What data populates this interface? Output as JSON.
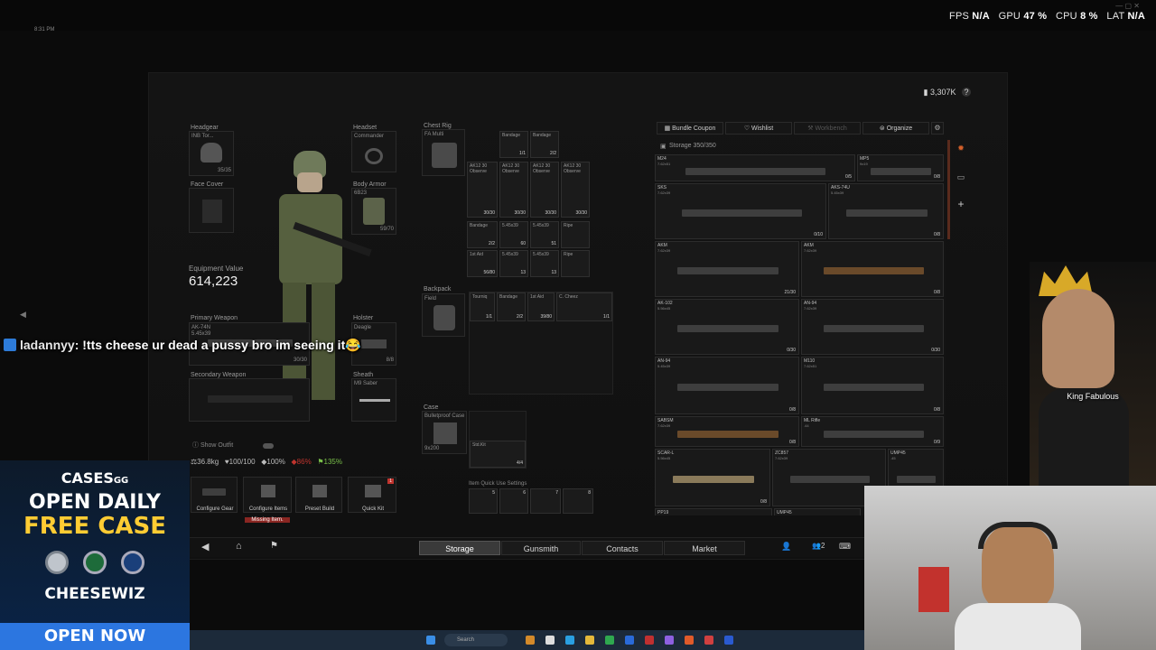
{
  "overlay": {
    "time": "8:31 PM",
    "fps_label": "FPS",
    "fps_value": "N/A",
    "gpu_label": "GPU",
    "gpu_value": "47 %",
    "cpu_label": "CPU",
    "cpu_value": "8 %",
    "lat_label": "LAT",
    "lat_value": "N/A"
  },
  "header": {
    "money": "3,307K",
    "help": "?"
  },
  "equipment": {
    "headgear": {
      "label": "Headgear",
      "item": "INB Tor...",
      "durability": "35/35"
    },
    "headset": {
      "label": "Headset",
      "item": "Commander"
    },
    "face_cover": {
      "label": "Face Cover"
    },
    "body_armor": {
      "label": "Body Armor",
      "item": "6B23",
      "durability": "59/70"
    },
    "equipment_value_label": "Equipment Value",
    "equipment_value": "614,223",
    "primary_weapon": {
      "label": "Primary Weapon",
      "item": "AK-74N",
      "sub": "5.45x39",
      "ammo": "30/30"
    },
    "holster": {
      "label": "Holster",
      "item": "Deagle",
      "ammo": "8/8"
    },
    "secondary_weapon": {
      "label": "Secondary Weapon"
    },
    "sheath": {
      "label": "Sheath",
      "item": "M9 Saber"
    },
    "show_outfit": "Show Outfit",
    "stats": {
      "weight": "36.8kg",
      "hp": "100/100",
      "hydration": "100%",
      "energy": "86%",
      "mod": "135%"
    },
    "actions": [
      {
        "label": "Configure Gear"
      },
      {
        "label": "Configure Items",
        "warning": "Missing Item."
      },
      {
        "label": "Preset Build"
      },
      {
        "label": "Quick Kit",
        "badge": "1"
      }
    ]
  },
  "chest_rig": {
    "label": "Chest Rig",
    "item": "FA Multi",
    "items": [
      {
        "name": "Bandage",
        "qty": "1/1"
      },
      {
        "name": "Bandage",
        "qty": "2/2"
      },
      {
        "name": "AK12 30 Observe",
        "qty": "30/30"
      },
      {
        "name": "AK12 30 Observe",
        "qty": "30/30"
      },
      {
        "name": "AK12 30 Observe",
        "qty": "30/30"
      },
      {
        "name": "AK12 30 Observe",
        "qty": "30/30"
      },
      {
        "name": "Bandage",
        "qty": "2/2"
      },
      {
        "name": "5.45x39",
        "qty": "60"
      },
      {
        "name": "5.45x39",
        "qty": "51"
      },
      {
        "name": "Ripe",
        "qty": ""
      },
      {
        "name": "1st Aid",
        "qty": "56/80"
      },
      {
        "name": "5.45x39",
        "qty": "13"
      },
      {
        "name": "5.45x39",
        "qty": "13"
      },
      {
        "name": "Ripe",
        "qty": ""
      }
    ]
  },
  "backpack": {
    "label": "Backpack",
    "item": "Field",
    "items": [
      {
        "name": "Tourniq",
        "qty": "1/1"
      },
      {
        "name": "Bandage",
        "qty": "2/2"
      },
      {
        "name": "1st Aid",
        "qty": "39/80"
      },
      {
        "name": "C. Cheez",
        "qty": "1/1"
      }
    ]
  },
  "case": {
    "label": "Case",
    "item": "Bulletproof Case",
    "size": "9x200",
    "sub_item": "Std.Kit",
    "sub_qty": "4/4"
  },
  "quick_use": {
    "label": "Item Quick Use Settings",
    "slots": [
      "5",
      "6",
      "7",
      "8"
    ]
  },
  "storage_tabs": {
    "bundle": "Bundle Coupon",
    "wishlist": "Wishlist",
    "workbench": "Workbench",
    "organize": "Organize"
  },
  "storage": {
    "label": "Storage 350/350",
    "weapons": [
      {
        "name": "M24",
        "sub": "7.62x51",
        "count": "0/5"
      },
      {
        "name": "MP5",
        "sub": "9x19",
        "count": "0/8"
      },
      {
        "name": "SKS",
        "sub": "7.62x39",
        "count": "0/10"
      },
      {
        "name": "AKS-74U",
        "sub": "5.45x39",
        "count": "0/8"
      },
      {
        "name": "AKM",
        "sub": "7.62x39",
        "count": "21/30"
      },
      {
        "name": "AKM",
        "sub": "7.62x39",
        "count": "0/8"
      },
      {
        "name": "AK-102",
        "sub": "5.56x45",
        "count": "0/30"
      },
      {
        "name": "AN-94",
        "sub": "7.62x39",
        "count": "0/30"
      },
      {
        "name": "AN-94",
        "sub": "5.45x39",
        "count": "0/8"
      },
      {
        "name": "M110",
        "sub": "7.62x51",
        "count": "0/8"
      },
      {
        "name": "SABSM",
        "sub": "7.62x39",
        "count": "0/8"
      },
      {
        "name": "ML Rifle",
        "sub": ".44",
        "count": "0/9"
      },
      {
        "name": "SCAR-L",
        "sub": "5.56x45",
        "count": "0/8"
      },
      {
        "name": "ZC857",
        "sub": "7.62x39",
        "count": ""
      },
      {
        "name": "UMP45",
        "sub": ".45",
        "count": ""
      },
      {
        "name": "PP19",
        "sub": "9x19",
        "count": ""
      },
      {
        "name": "UMP45",
        "sub": ".45",
        "count": ""
      }
    ]
  },
  "nav": {
    "storage": "Storage",
    "gunsmith": "Gunsmith",
    "contacts": "Contacts",
    "market": "Market",
    "party_count": "2"
  },
  "chat": {
    "user": "ladannyy:",
    "message": "!tts cheese ur dead a pussy bro im seeing it😂"
  },
  "ad": {
    "brand": "CASES",
    "brand_suffix": "GG",
    "line1": "OPEN DAILY",
    "line2": "FREE CASE",
    "code": "CHEESEWIZ",
    "cta": "OPEN NOW"
  },
  "webcam": {
    "name": "King Fabulous"
  },
  "taskbar": {
    "search": "Search"
  },
  "colors": {
    "accent": "#2c76e0",
    "warning": "#c0342e",
    "hp": "#d0d0d0"
  }
}
